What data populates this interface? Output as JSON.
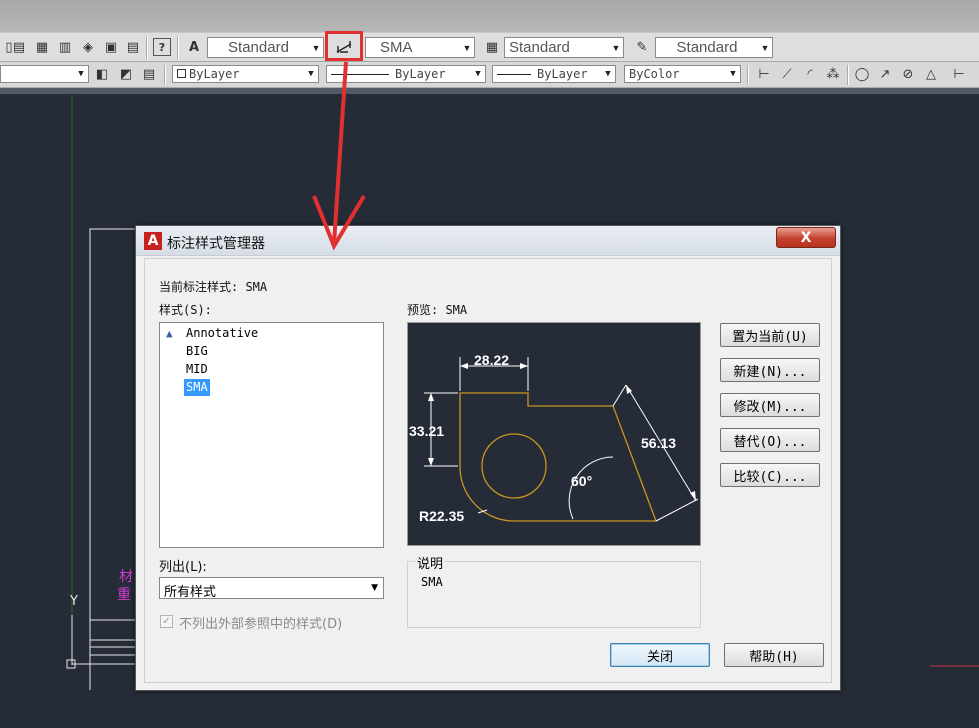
{
  "toolbar1": {
    "text_style": "Standard",
    "dim_style": "SMA",
    "table_style": "Standard",
    "multileader_style": "Standard"
  },
  "toolbar2": {
    "color": "ByLayer",
    "linetype": "ByLayer",
    "lineweight": "ByLayer",
    "plotstyle": "ByColor"
  },
  "dialog": {
    "title": "标注样式管理器",
    "close_glyph": "X",
    "current_style_label": "当前标注样式: SMA",
    "styles_label": "样式(S):",
    "styles": [
      "Annotative",
      "BIG",
      "MID",
      "SMA"
    ],
    "selected_style": "SMA",
    "preview_label": "预览: SMA",
    "list_label": "列出(L):",
    "list_value": "所有样式",
    "xref_checkbox_label": "不列出外部参照中的样式(D)",
    "description_label": "说明",
    "description_value": "SMA",
    "buttons": {
      "set_current": "置为当前(U)",
      "new": "新建(N)...",
      "modify": "修改(M)...",
      "override": "替代(O)...",
      "compare": "比较(C)...",
      "close": "关闭",
      "help": "帮助(H)"
    }
  },
  "preview_dims": {
    "width": "28.22",
    "height": "33.21",
    "slant": "56.13",
    "angle": "60°",
    "radius": "R22.35"
  },
  "background": {
    "axis_y": "Y",
    "side_text_1": "材",
    "side_text_2": "重"
  },
  "colors": {
    "canvas": "#252c38",
    "highlight": "#e23030",
    "selection": "#3399ff",
    "geometry": "#c8961e"
  }
}
